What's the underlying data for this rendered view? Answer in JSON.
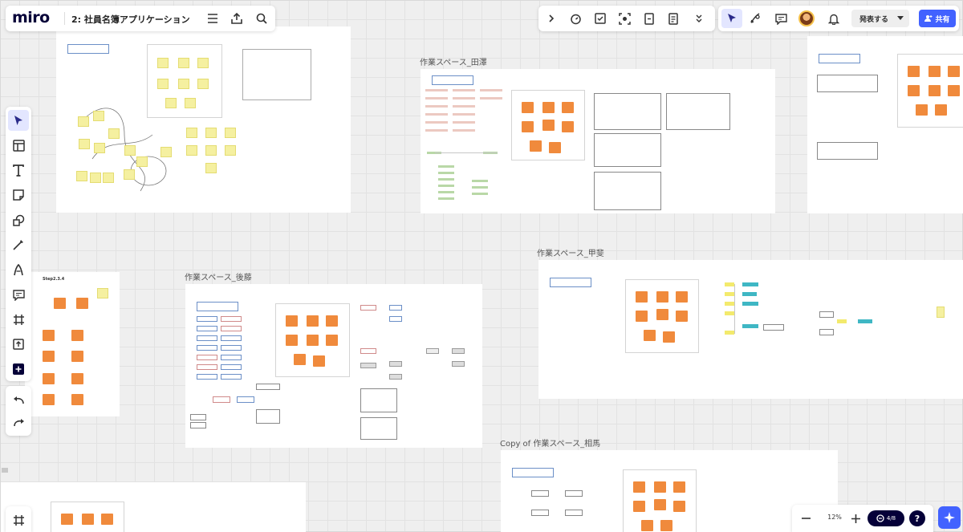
{
  "app": {
    "logo": "miro",
    "board_title": "2: 社員名簿アプリケーション"
  },
  "toolbar": {
    "present_label": "発表する",
    "share_label": "共有",
    "zoom_level": "12%",
    "pages_label": "4/8",
    "help_label": "?"
  },
  "frames": {
    "top_center": "作業スペース_田澤",
    "bottom_left": "作業スペース_後藤",
    "mid_right": "作業スペース_甲斐",
    "bottom_right": "Copy of 作業スペース_相馬",
    "left_small": "Step2.3.4"
  },
  "icons": {
    "left_toolbar": [
      "select-icon",
      "templates-icon",
      "text-icon",
      "sticky-note-icon",
      "shapes-icon",
      "pen-icon",
      "comment-pen-icon",
      "comment-icon",
      "frame-icon",
      "upload-icon",
      "more-apps-icon",
      "undo-icon",
      "redo-icon"
    ],
    "top_bar": [
      "menu-icon",
      "export-icon",
      "search-icon"
    ],
    "top_right": [
      "expand-icon",
      "timer-icon",
      "voting-icon",
      "screen-capture-icon",
      "cards-icon",
      "doc-icon",
      "more-icon",
      "cursor-follow-icon",
      "reactions-icon",
      "chat-icon",
      "avatar",
      "bell-icon",
      "chevron-down-icon",
      "share-user-icon"
    ]
  },
  "colors": {
    "accent": "#4262ff",
    "sticky_orange": "#f08a3c",
    "sticky_yellow": "#f5f0a0",
    "teal": "#3fb7c4"
  }
}
